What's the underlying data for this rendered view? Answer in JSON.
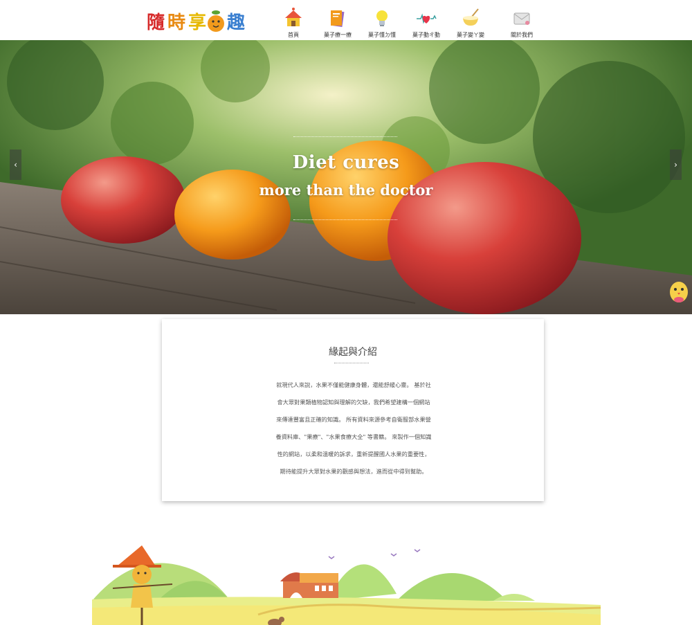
{
  "logo": {
    "chars": [
      "隨",
      "時",
      "享",
      "趣"
    ],
    "colors": [
      "#d62a2a",
      "#e88a12",
      "#e6b800",
      "#3a7fd0"
    ]
  },
  "nav": {
    "items": [
      {
        "label": "首頁",
        "icon": "house-icon"
      },
      {
        "label": "菓子療一療",
        "icon": "book-icon"
      },
      {
        "label": "菓子懂ㄉ懂",
        "icon": "lightbulb-icon"
      },
      {
        "label": "菓子動ㄔ動",
        "icon": "heartbeat-icon"
      },
      {
        "label": "菓子變ㄚ變",
        "icon": "mixing-bowl-icon"
      },
      {
        "label": "關於我們",
        "icon": "envelope-icon"
      }
    ]
  },
  "hero": {
    "line1": "Diet cures",
    "line2": "more than the doctor",
    "prev_icon": "chevron-left-icon",
    "next_icon": "chevron-right-icon",
    "prev_glyph": "‹",
    "next_glyph": "›",
    "mascot_icon": "chick-mascot-icon"
  },
  "intro": {
    "title": "緣起與介紹",
    "lines": [
      "就現代人來說，水果不僅能健康身體，還能舒緩心靈。 基於社",
      "會大眾對果類植物認知與理解的欠缺，我們希望建構一個網站",
      "來傳達豐富且正確的知識。 所有資料來源參考自衛服部水果營",
      "養資料庫、\"果療\"、\"水果食療大全\" 等書籍。 來製作一個知識",
      "性的網站，以柔和溫暖的訴求，重新提醒國人水果的重要性，",
      "期待能提升大眾對水果的觀感與想法，進而從中得到幫助。"
    ]
  },
  "colors": {
    "accent_orange": "#f29a1c",
    "apple_red": "#d23a3a",
    "hill_green": "#a9d86a",
    "field_yellow": "#e9ee8a"
  }
}
